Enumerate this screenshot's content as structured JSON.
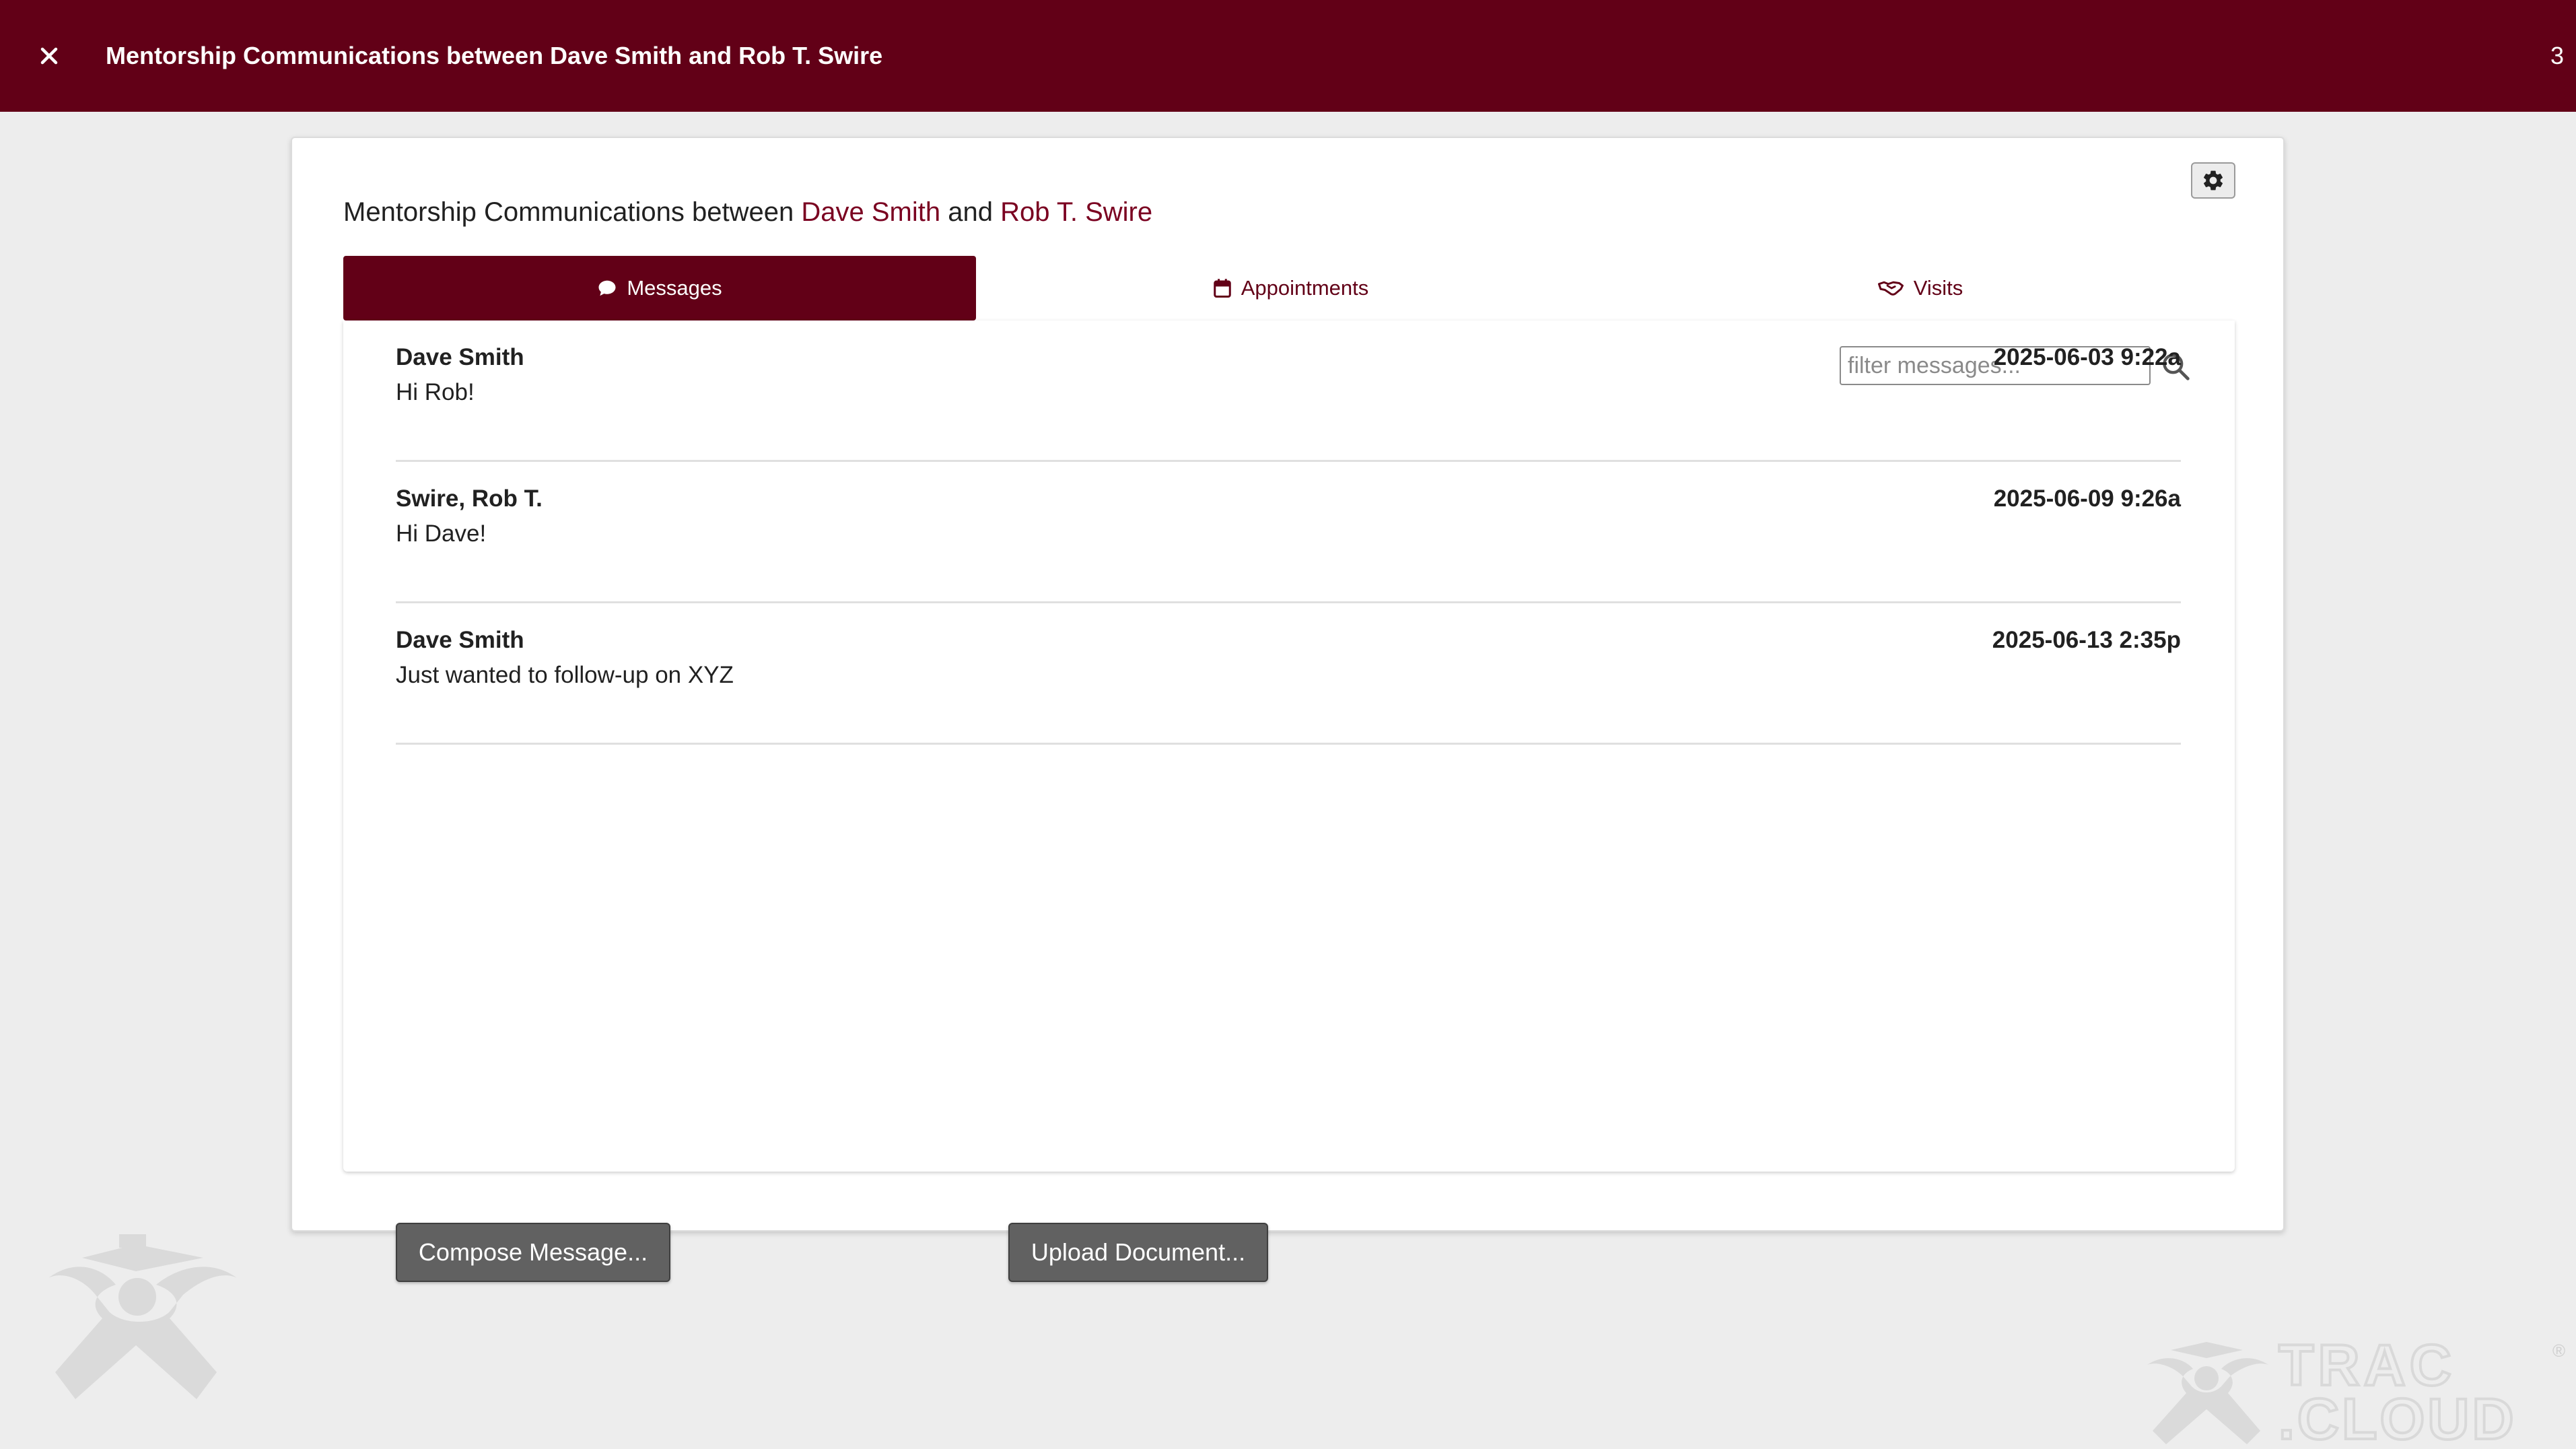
{
  "header": {
    "title": "Mentorship Communications between Dave Smith and Rob T. Swire",
    "count": "3",
    "bg_color": "#620017"
  },
  "card": {
    "heading_prefix": "Mentorship Communications between",
    "mentor": "Dave Smith",
    "conjunction": "and",
    "mentee": "Rob T. Swire"
  },
  "tabs": [
    {
      "label": "Messages",
      "icon": "comment-icon",
      "active": true
    },
    {
      "label": "Appointments",
      "icon": "calendar-icon",
      "active": false
    },
    {
      "label": "Visits",
      "icon": "handshake-icon",
      "active": false
    }
  ],
  "filter": {
    "placeholder": "filter messages...",
    "value": ""
  },
  "messages": [
    {
      "sender": "Dave Smith",
      "text": "Hi Rob!",
      "date": "2025-06-03 9:22a"
    },
    {
      "sender": "Swire, Rob T.",
      "text": "Hi Dave!",
      "date": "2025-06-09 9:26a"
    },
    {
      "sender": "Dave Smith",
      "text": "Just wanted to follow-up on XYZ",
      "date": "2025-06-13 2:35p"
    }
  ],
  "buttons": {
    "compose": "Compose Message...",
    "upload": "Upload Document..."
  },
  "watermark": {
    "brand_top": "TRAC",
    "brand_bottom": ".CLOUD",
    "registered": "®"
  },
  "accent_color": "#620017"
}
